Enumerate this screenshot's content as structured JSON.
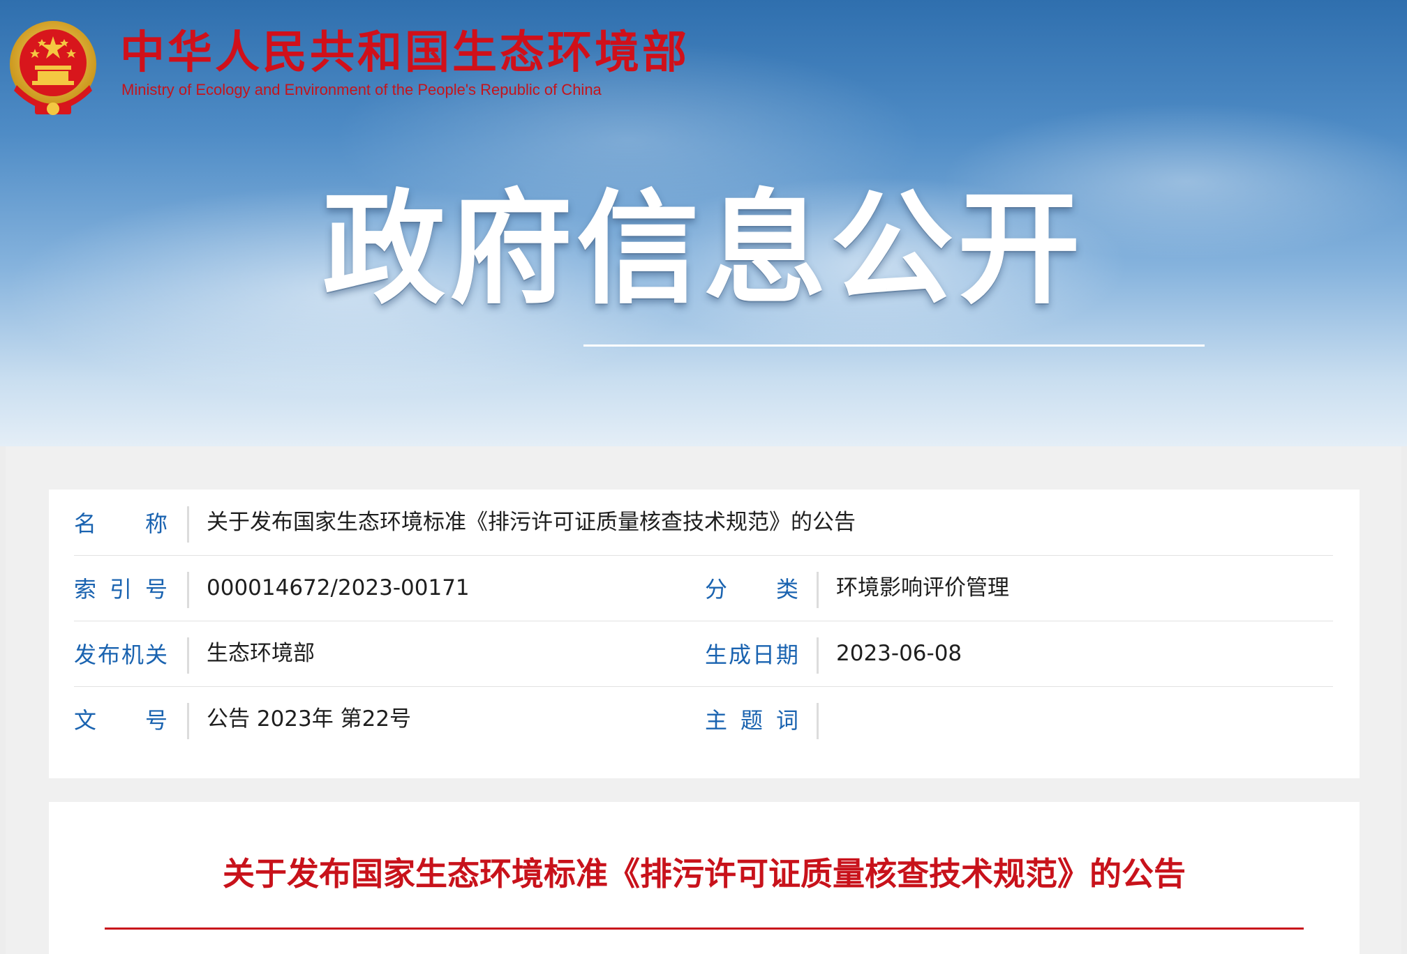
{
  "header": {
    "brand_cn": "中华人民共和国生态环境部",
    "brand_en": "Ministry of Ecology and Environment of the People's Republic of China",
    "hero_title": "政府信息公开",
    "emblem_icon": "national-emblem-icon"
  },
  "meta": {
    "name_label": "名称",
    "name_value": "关于发布国家生态环境标准《排污许可证质量核查技术规范》的公告",
    "index_label": "索引号",
    "index_value": "000014672/2023-00171",
    "category_label": "分类",
    "category_value": "环境影响评价管理",
    "issuer_label": "发布机关",
    "issuer_value": "生态环境部",
    "date_label": "生成日期",
    "date_value": "2023-06-08",
    "doc_no_label": "文号",
    "doc_no_value": "公告 2023年 第22号",
    "keywords_label": "主题词",
    "keywords_value": ""
  },
  "article": {
    "title": "关于发布国家生态环境标准《排污许可证质量核查技术规范》的公告"
  },
  "colors": {
    "brand_red": "#d0101a",
    "label_blue": "#1a63b0",
    "title_red": "#c8121b"
  }
}
